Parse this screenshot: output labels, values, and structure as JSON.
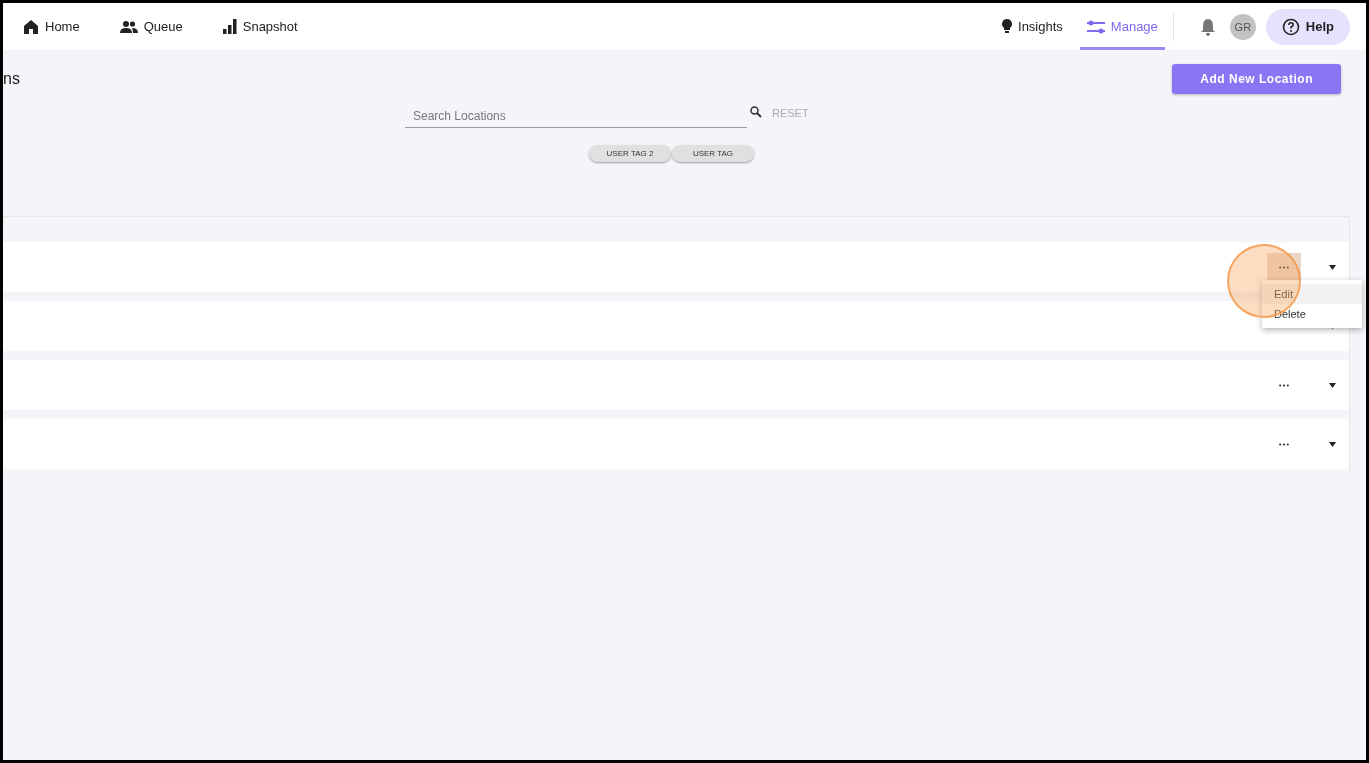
{
  "nav": {
    "left": [
      {
        "label": "Home",
        "kind": "home"
      },
      {
        "label": "Queue",
        "kind": "people"
      },
      {
        "label": "Snapshot",
        "kind": "bars"
      }
    ],
    "right": [
      {
        "label": "Insights",
        "kind": "bulb",
        "selected": false
      },
      {
        "label": "Manage",
        "kind": "sliders",
        "selected": true
      }
    ],
    "avatar": "GR",
    "help": "Help"
  },
  "page": {
    "title": "ns",
    "add_button": "Add New Location"
  },
  "search": {
    "placeholder": "Search Locations",
    "reset": "RESET"
  },
  "tags": [
    "USER TAG 2",
    "USER TAG"
  ],
  "rows": [
    {
      "menu_open": true
    },
    {
      "menu_open": false
    },
    {
      "menu_open": false
    },
    {
      "menu_open": false
    }
  ],
  "menu": [
    "Edit",
    "Delete"
  ]
}
